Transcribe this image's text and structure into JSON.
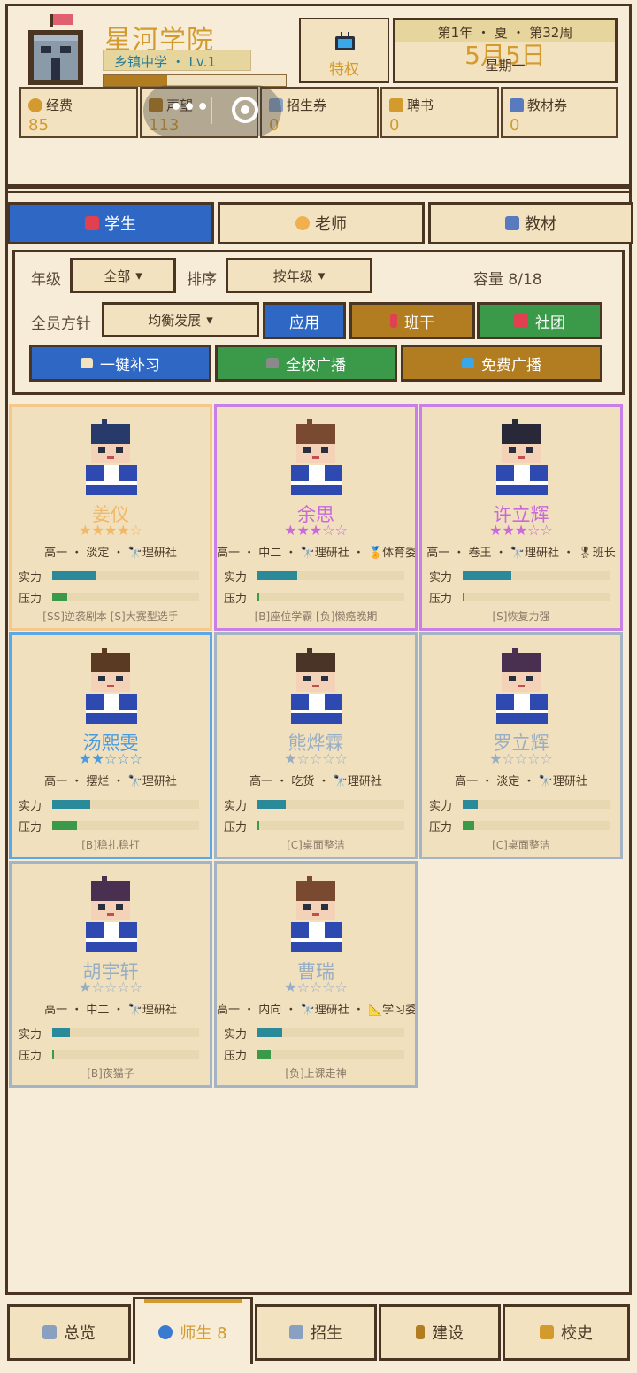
{
  "school": {
    "name": "星河学院",
    "sub": "乡镇中学 ・ Lv.1",
    "xp_fraction": 0.35
  },
  "privilege": {
    "label": "特权"
  },
  "date": {
    "top": "第1年 ・ 夏 ・ 第32周",
    "month_day": "5月5日",
    "weekday": "星期一"
  },
  "resources": [
    {
      "name": "经费",
      "value": "85",
      "icon": "coin-bag-icon",
      "color": "#d39b2e"
    },
    {
      "name": "声望",
      "value": "113",
      "icon": "trophy-icon",
      "color": "#b27d20"
    },
    {
      "name": "招生券",
      "value": "0",
      "icon": "ticket-icon",
      "color": "#8aa0c0"
    },
    {
      "name": "聘书",
      "value": "0",
      "icon": "scroll-icon",
      "color": "#d39b2e"
    },
    {
      "name": "教材券",
      "value": "0",
      "icon": "books-icon",
      "color": "#5a7ac0"
    }
  ],
  "capsule": {
    "dots": "•••"
  },
  "tabs": [
    {
      "label": "学生",
      "icon": "backpack-icon",
      "active": true
    },
    {
      "label": "老师",
      "icon": "teacher-icon",
      "active": false
    },
    {
      "label": "教材",
      "icon": "books-icon",
      "active": false
    }
  ],
  "filters": {
    "grade_label": "年级",
    "grade_value": "全部",
    "sort_label": "排序",
    "sort_value": "按年级",
    "capacity": "容量 8/18",
    "policy_label": "全员方针",
    "policy_value": "均衡发展",
    "apply": "应用",
    "monitor": "班干",
    "club": "社团",
    "tutor": "一键补习",
    "broadcast": "全校广播",
    "free_broadcast": "免费广播"
  },
  "students": [
    {
      "name": "姜仪",
      "stars": 4,
      "tags": "高一 ・ 淡定 ・ 🔭理研社",
      "strength": 0.3,
      "pressure": 0.1,
      "traits": "[SS]逆袭剧本 [S]大赛型选手",
      "name_color": "#f0b868",
      "border": "#f3c88a",
      "hair": "#283a6a"
    },
    {
      "name": "余思",
      "stars": 3,
      "tags": "高一 ・ 中二 ・ 🔭理研社 ・ 🏅体育委员",
      "strength": 0.27,
      "pressure": 0.01,
      "traits": "[B]座位学霸 [负]懒癌晚期",
      "name_color": "#c86ad8",
      "border": "#c880e8",
      "hair": "#7a4a30"
    },
    {
      "name": "许立辉",
      "stars": 3,
      "tags": "高一 ・ 卷王 ・ 🔭理研社 ・ 🎖班长",
      "strength": 0.33,
      "pressure": 0.01,
      "traits": "[S]恢复力强",
      "name_color": "#c86ad8",
      "border": "#c880e8",
      "hair": "#282838"
    },
    {
      "name": "汤熙雯",
      "stars": 2,
      "tags": "高一 ・ 摆烂 ・ 🔭理研社",
      "strength": 0.26,
      "pressure": 0.17,
      "traits": "[B]稳扎稳打",
      "name_color": "#4a9ae0",
      "border": "#5aa8e8",
      "hair": "#5a3a22"
    },
    {
      "name": "熊烨霖",
      "stars": 1,
      "tags": "高一 ・ 吃货 ・ 🔭理研社",
      "strength": 0.19,
      "pressure": 0.01,
      "traits": "[C]桌面整洁",
      "name_color": "#98aec4",
      "border": "#a4b4c4",
      "hair": "#4a3428"
    },
    {
      "name": "罗立辉",
      "stars": 1,
      "tags": "高一 ・ 淡定 ・ 🔭理研社",
      "strength": 0.1,
      "pressure": 0.08,
      "traits": "[C]桌面整洁",
      "name_color": "#98aec4",
      "border": "#a4b4c4",
      "hair": "#4a3050"
    },
    {
      "name": "胡宇轩",
      "stars": 1,
      "tags": "高一 ・ 中二 ・ 🔭理研社",
      "strength": 0.12,
      "pressure": 0.01,
      "traits": "[B]夜猫子",
      "name_color": "#98aec4",
      "border": "#a4b4c4",
      "hair": "#4a3050"
    },
    {
      "name": "曹瑞",
      "stars": 1,
      "tags": "高一 ・ 内向 ・ 🔭理研社 ・ 📐学习委员",
      "strength": 0.17,
      "pressure": 0.09,
      "traits": "[负]上课走神",
      "name_color": "#98aec4",
      "border": "#a4b4c4",
      "hair": "#7a4a30"
    }
  ],
  "bar_labels": {
    "strength": "实力",
    "pressure": "压力"
  },
  "nav": [
    {
      "label": "总览",
      "icon": "building-icon",
      "active": false
    },
    {
      "label": "师生 8",
      "icon": "people-icon",
      "active": true
    },
    {
      "label": "招生",
      "icon": "ticket-icon",
      "active": false
    },
    {
      "label": "建设",
      "icon": "hammer-icon",
      "active": false
    },
    {
      "label": "校史",
      "icon": "scroll-icon",
      "active": false
    }
  ]
}
